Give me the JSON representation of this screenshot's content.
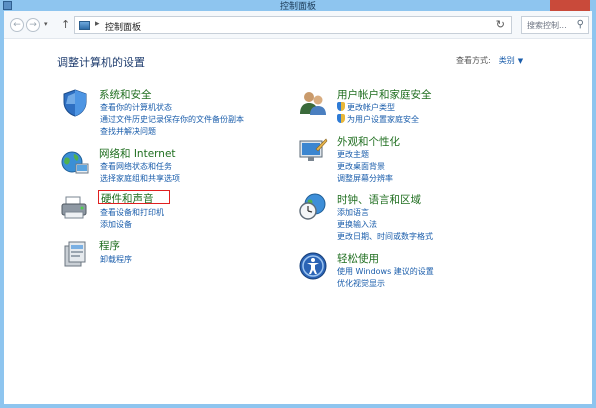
{
  "window": {
    "title": "控制面板"
  },
  "nav": {
    "path": "控制面板",
    "search_placeholder": "搜索控制..."
  },
  "header": {
    "title": "调整计算机的设置",
    "view_by_label": "查看方式:",
    "view_by_value": "类别"
  },
  "categories": {
    "system": {
      "title": "系统和安全",
      "links": [
        "查看你的计算机状态",
        "通过文件历史记录保存你的文件备份副本",
        "查找并解决问题"
      ]
    },
    "network": {
      "title": "网络和 Internet",
      "links": [
        "查看网络状态和任务",
        "选择家庭组和共享选项"
      ]
    },
    "hardware": {
      "title": "硬件和声音",
      "links": [
        "查看设备和打印机",
        "添加设备"
      ]
    },
    "programs": {
      "title": "程序",
      "links": [
        "卸载程序"
      ]
    },
    "users": {
      "title": "用户帐户和家庭安全",
      "links": [
        "更改帐户类型",
        "为用户设置家庭安全"
      ]
    },
    "appearance": {
      "title": "外观和个性化",
      "links": [
        "更改主题",
        "更改桌面背景",
        "调整屏幕分辨率"
      ]
    },
    "clock": {
      "title": "时钟、语言和区域",
      "links": [
        "添加语言",
        "更换输入法",
        "更改日期、时间或数字格式"
      ]
    },
    "ease": {
      "title": "轻松使用",
      "links": [
        "使用 Windows 建议的设置",
        "优化视觉显示"
      ]
    }
  },
  "colors": {
    "heading_green": "#1f6e1f",
    "link_blue": "#1a5dab",
    "highlight_red": "#e02020",
    "titlebar": "#8ec5ef"
  }
}
